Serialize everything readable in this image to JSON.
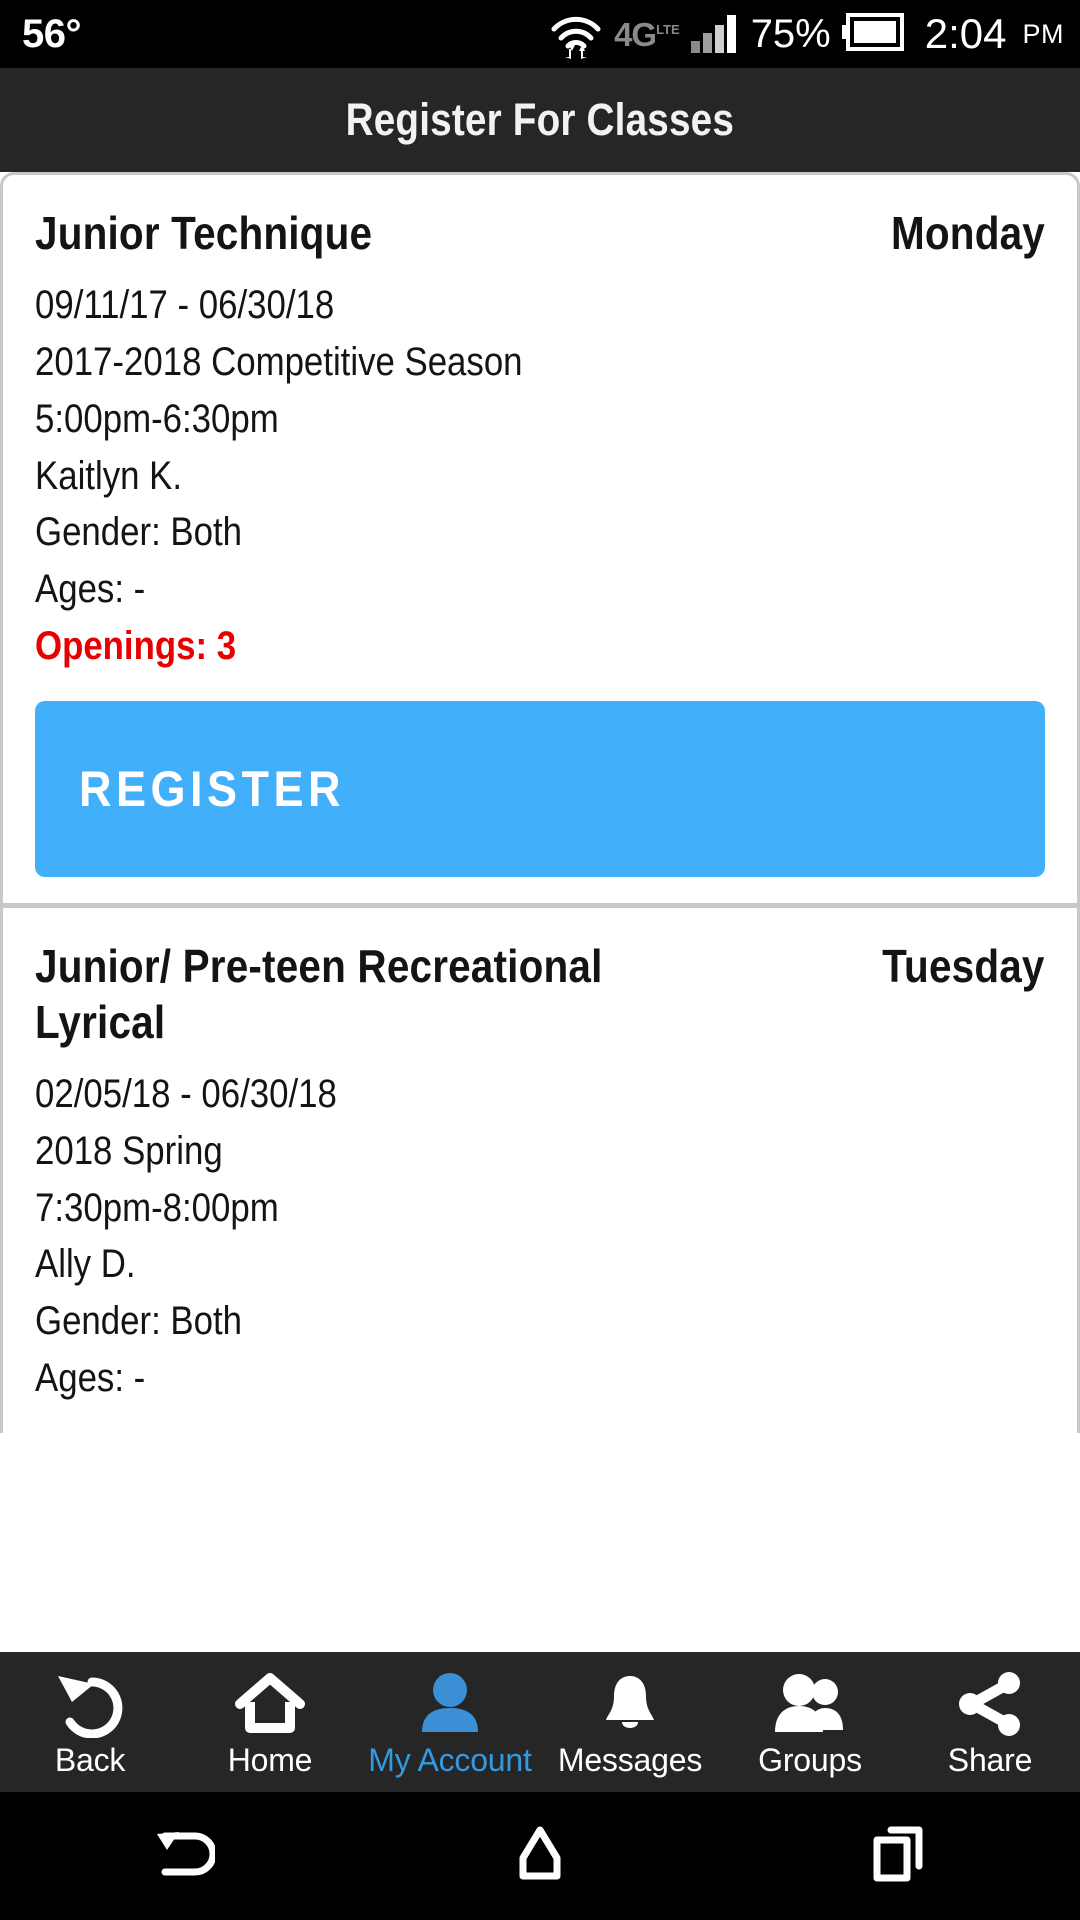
{
  "statusbar": {
    "temperature": "56°",
    "network_type": "4G",
    "network_sup": "LTE",
    "battery_percent": "75%",
    "time": "2:04",
    "ampm": "PM",
    "icons": [
      "wifi-icon",
      "data-transfer-icon",
      "signal-bars-icon",
      "battery-icon"
    ]
  },
  "header": {
    "title": "Register For Classes"
  },
  "classes": [
    {
      "name": "Junior Technique",
      "day": "Monday",
      "date_range": "09/11/17 - 06/30/18",
      "season": "2017-2018 Competitive Season",
      "time": "5:00pm-6:30pm",
      "instructor": "Kaitlyn K.",
      "gender": "Gender: Both",
      "ages": "Ages: -",
      "openings": "Openings: 3",
      "register_label": "REGISTER"
    },
    {
      "name": "Junior/ Pre-teen Recreational Lyrical",
      "day": "Tuesday",
      "date_range": "02/05/18 - 06/30/18",
      "season": "2018 Spring",
      "time": "7:30pm-8:00pm",
      "instructor": "Ally D.",
      "gender": "Gender: Both",
      "ages": "Ages: -"
    }
  ],
  "bottom_nav": {
    "items": [
      {
        "label": "Back",
        "icon": "undo-arrow-icon",
        "active": false
      },
      {
        "label": "Home",
        "icon": "house-icon",
        "active": false
      },
      {
        "label": "My Account",
        "icon": "person-icon",
        "active": true
      },
      {
        "label": "Messages",
        "icon": "bell-icon",
        "active": false
      },
      {
        "label": "Groups",
        "icon": "people-group-icon",
        "active": false
      },
      {
        "label": "Share",
        "icon": "share-nodes-icon",
        "active": false
      }
    ]
  },
  "system_nav": {
    "items": [
      {
        "icon": "android-back-icon"
      },
      {
        "icon": "android-home-icon"
      },
      {
        "icon": "android-recents-icon"
      }
    ]
  },
  "colors": {
    "accent_blue": "#42AFFA",
    "nav_active_blue": "#3399E0",
    "openings_red": "#E80000",
    "titlebar_bg": "#262626",
    "card_border": "#C8C8C8"
  }
}
